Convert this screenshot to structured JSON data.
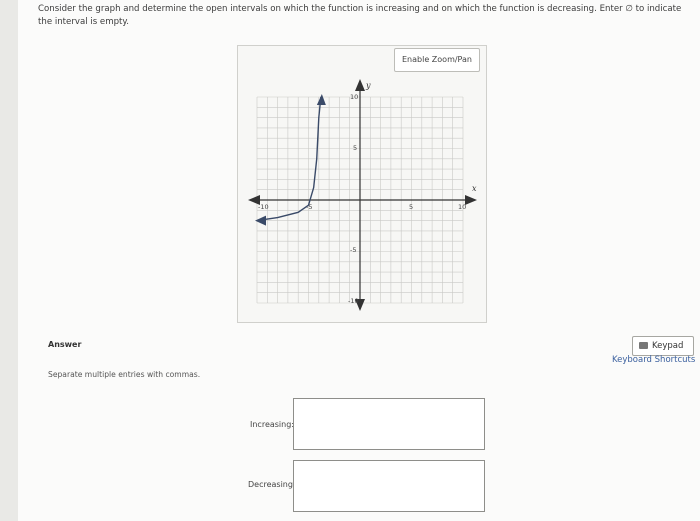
{
  "question": {
    "text": "Consider the graph and determine the open intervals on which the function is increasing and on which the function is decreasing. Enter ∅ to indicate the interval is empty."
  },
  "graph": {
    "zoom_button_label": "Enable Zoom/Pan",
    "axis_labels": {
      "x": "x",
      "y": "y"
    },
    "tick_labels": {
      "x_neg10": "-10",
      "x_neg5": "-5",
      "x_5": "5",
      "x_10": "10",
      "y_10": "10",
      "y_5": "5",
      "y_neg5": "-5",
      "y_neg10": "-10"
    },
    "curve_points": [
      [
        -10,
        -2
      ],
      [
        -8,
        -1.7
      ],
      [
        -6,
        -1.2
      ],
      [
        -5,
        -0.5
      ],
      [
        -4.5,
        1.2
      ],
      [
        -4.2,
        4
      ],
      [
        -4,
        8
      ],
      [
        -3.8,
        10
      ]
    ]
  },
  "answer": {
    "heading": "Answer",
    "hint": "Separate multiple entries with commas.",
    "keypad_label": "Keypad",
    "shortcuts_label": "Keyboard Shortcuts",
    "increasing_label": "Increasing:",
    "increasing_value": "",
    "decreasing_label": "Decreasing:",
    "decreasing_value": ""
  }
}
